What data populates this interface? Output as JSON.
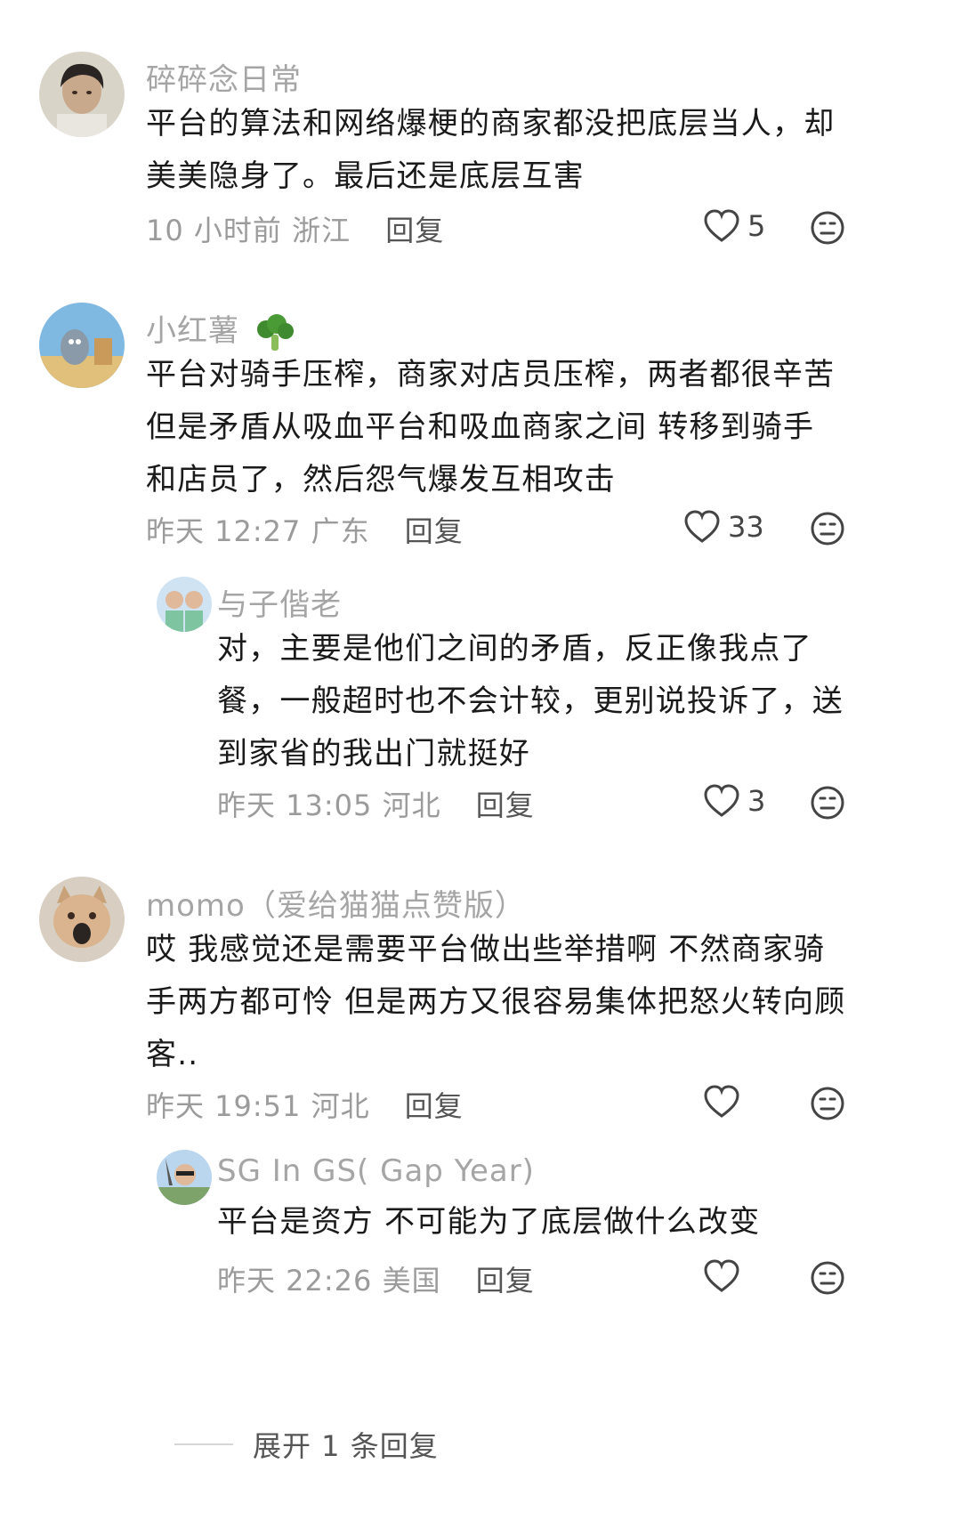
{
  "comments": [
    {
      "username": "碎碎念日常",
      "text": "平台的算法和网络爆梗的商家都没把底层当人，却美美隐身了。最后还是底层互害",
      "time": "10 小时前",
      "location": "浙江",
      "reply_label": "回复",
      "likes": "5"
    },
    {
      "username": "小红薯",
      "text": "平台对骑手压榨，商家对店员压榨，两者都很辛苦但是矛盾从吸血平台和吸血商家之间 转移到骑手和店员了，然后怨气爆发互相攻击",
      "time": "昨天 12:27",
      "location": "广东",
      "reply_label": "回复",
      "likes": "33"
    },
    {
      "username": "与子偕老",
      "text": "对，主要是他们之间的矛盾，反正像我点了餐，一般超时也不会计较，更别说投诉了，送到家省的我出门就挺好",
      "time": "昨天 13:05",
      "location": "河北",
      "reply_label": "回复",
      "likes": "3"
    },
    {
      "username": "momo（爱给猫猫点赞版）",
      "text": "哎 我感觉还是需要平台做出些举措啊 不然商家骑手两方都可怜 但是两方又很容易集体把怒火转向顾客..",
      "time": "昨天 19:51",
      "location": "河北",
      "reply_label": "回复",
      "likes": ""
    },
    {
      "username": "SG In GS( Gap Year)",
      "text": "平台是资方 不可能为了底层做什么改变",
      "time": "昨天 22:26",
      "location": "美国",
      "reply_label": "回复",
      "likes": ""
    }
  ],
  "expand_label": "展开 1 条回复",
  "icons": {
    "like": "heart-icon",
    "dislike": "neutral-face-icon",
    "emoji": "broccoli-emoji"
  }
}
